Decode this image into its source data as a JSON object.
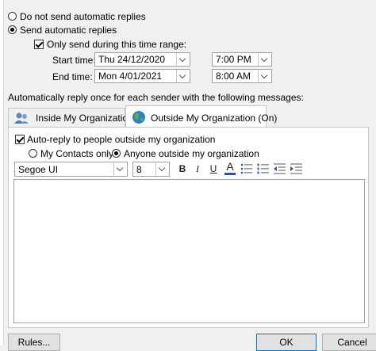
{
  "options": {
    "no_auto_reply": "Do not send automatic replies",
    "send_auto_reply": "Send automatic replies",
    "time_range": "Only send during this time range:"
  },
  "schedule": {
    "start_label": "Start time:",
    "start_date": "Thu 24/12/2020",
    "start_time": "7:00 PM",
    "end_label": "End time:",
    "end_date": "Mon 4/01/2021",
    "end_time": "8:00 AM"
  },
  "reply_note": "Automatically reply once for each sender with the following messages:",
  "tabs": [
    {
      "label": "Inside My Organization",
      "icon": "people-icon"
    },
    {
      "label": "Outside My Organization (On)",
      "icon": "globe-icon"
    }
  ],
  "outside": {
    "auto_reply_outside": "Auto-reply to people outside my organization",
    "contacts_only": "My Contacts only",
    "anyone_outside": "Anyone outside my organization"
  },
  "format": {
    "font": "Segoe UI",
    "size": "8",
    "bold": "B",
    "italic": "I",
    "underline": "U",
    "font_color": "A"
  },
  "buttons": {
    "rules": "Rules...",
    "ok": "OK",
    "cancel": "Cancel"
  },
  "colors": {
    "accent": "#0078d7",
    "font_color_bar": "#2b579a"
  }
}
